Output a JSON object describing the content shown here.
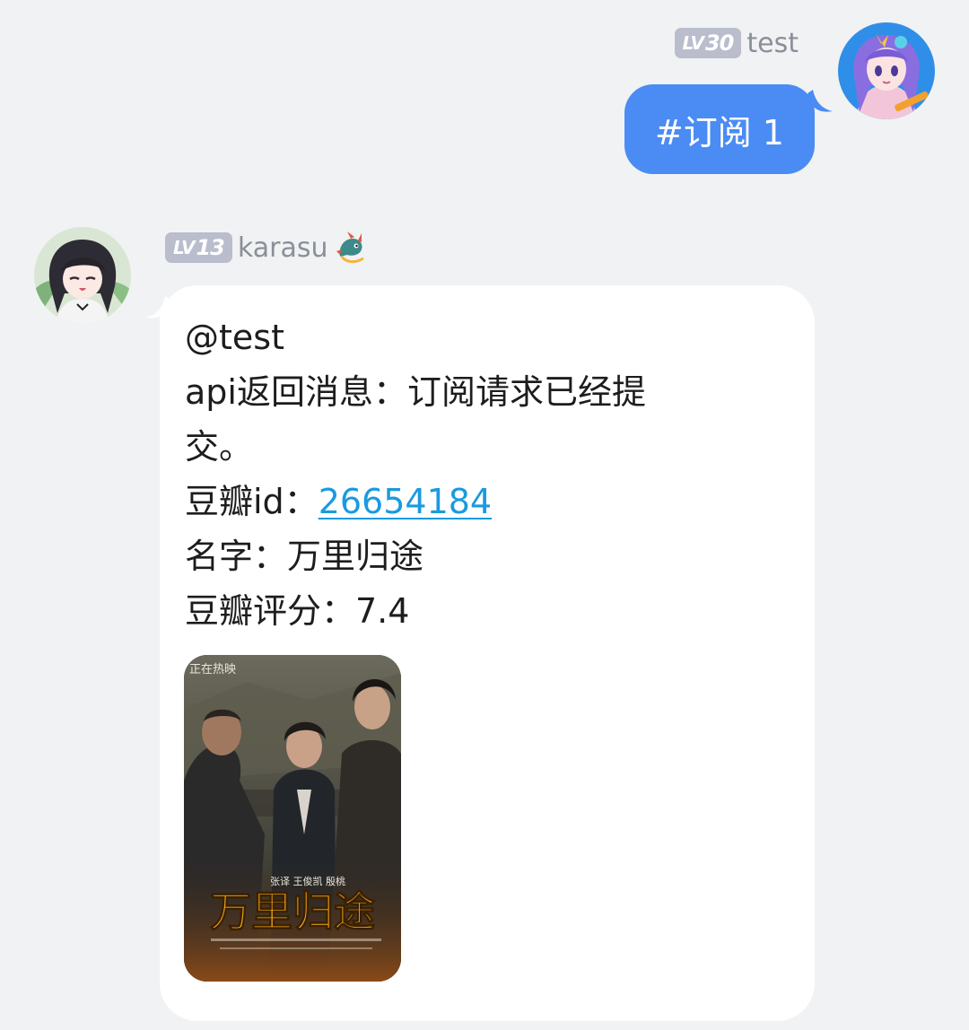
{
  "self": {
    "level_prefix": "LV",
    "level_number": "30",
    "name": "test",
    "avatar_icon": "anime-girl-purple-hair-avatar"
  },
  "outgoing_message": {
    "text": "#订阅 1",
    "color": "#4a8cf4"
  },
  "peer": {
    "level_prefix": "LV",
    "level_number": "13",
    "name": "karasu",
    "title_icon": "dragon-emoji-icon",
    "avatar_icon": "anime-girl-black-hair-avatar"
  },
  "incoming_message": {
    "mention": "@test",
    "api_line_1": "api返回消息：订阅请求已经提",
    "api_line_2": "交。",
    "douban_id_label": "豆瓣id：",
    "douban_id_value": "26654184",
    "name_line": "名字：万里归途",
    "rating_line": "豆瓣评分：7.4",
    "link_color": "#1a9ae0"
  },
  "poster": {
    "top_caption": "正在热映",
    "credit_line": "张译 王俊凯 殷桃",
    "title": "万里归途",
    "title_color": "#f2a81d"
  }
}
